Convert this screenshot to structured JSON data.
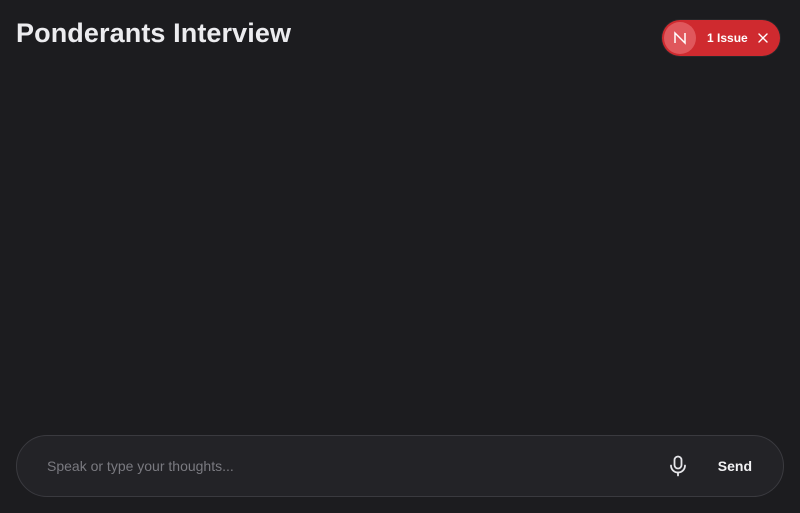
{
  "header": {
    "title": "Ponderants Interview"
  },
  "issues_indicator": {
    "badge_letter": "N",
    "label": "1 Issue",
    "close_icon": "close-icon",
    "color": "#cf2a2f"
  },
  "composer": {
    "placeholder": "Speak or type your thoughts...",
    "value": "",
    "mic_icon": "microphone-icon",
    "send_label": "Send"
  }
}
